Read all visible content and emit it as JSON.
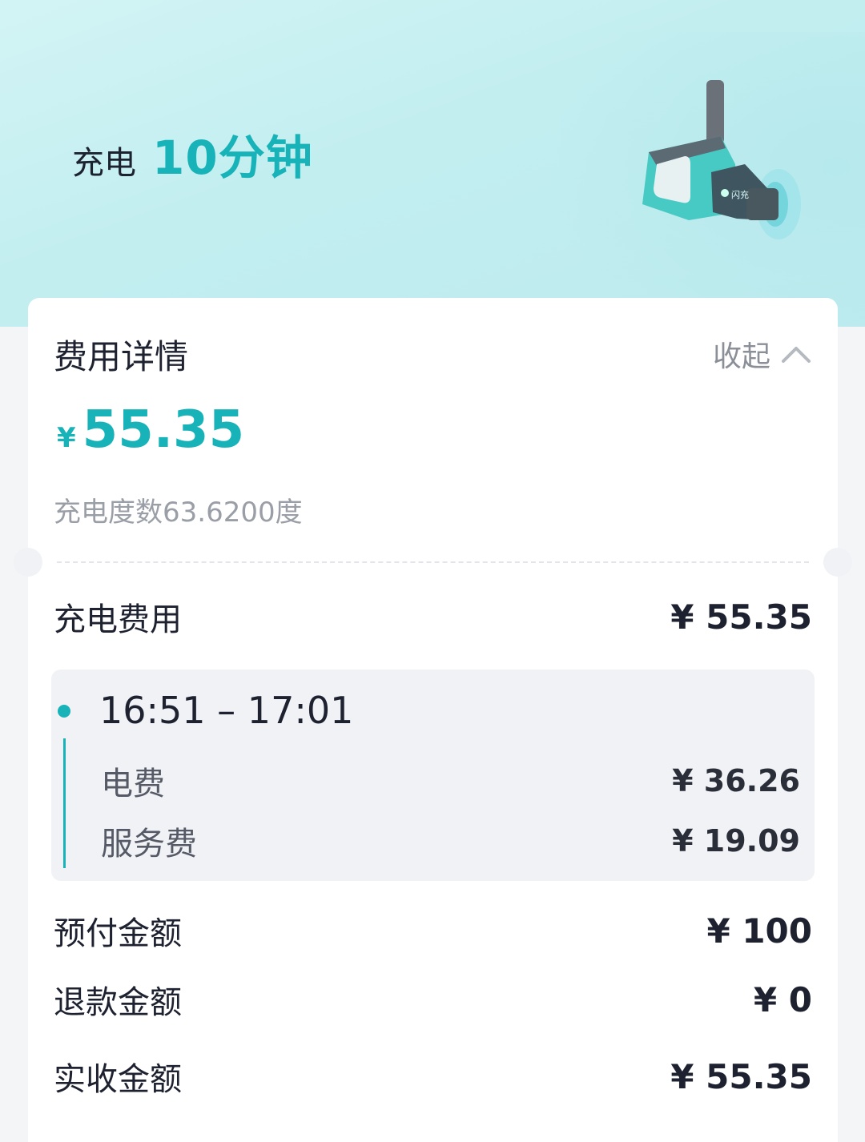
{
  "header": {
    "label": "充电",
    "duration": "10分钟",
    "plug_brand": "闪充"
  },
  "card": {
    "title": "费用详情",
    "collapse_label": "收起",
    "total": {
      "currency": "¥",
      "amount": "55.35"
    },
    "energy": "充电度数63.6200度",
    "charge_fee": {
      "label": "充电费用",
      "value": "¥ 55.35"
    },
    "period": {
      "time_range": "16:51 – 17:01",
      "items": [
        {
          "label": "电费",
          "value": "¥ 36.26"
        },
        {
          "label": "服务费",
          "value": "¥ 19.09"
        }
      ]
    },
    "prepaid": {
      "label": "预付金额",
      "value": "¥ 100"
    },
    "refund": {
      "label": "退款金额",
      "value": "¥ 0"
    },
    "received": {
      "label": "实收金额",
      "value": "¥ 55.35"
    }
  },
  "colors": {
    "accent": "#17b3b8",
    "hero_bg": "#c2eef0",
    "text_primary": "#1e2230",
    "text_muted": "#9a9ea6"
  },
  "icons": [
    "charger-plug-icon",
    "chevron-up-icon",
    "bolt-icon"
  ]
}
